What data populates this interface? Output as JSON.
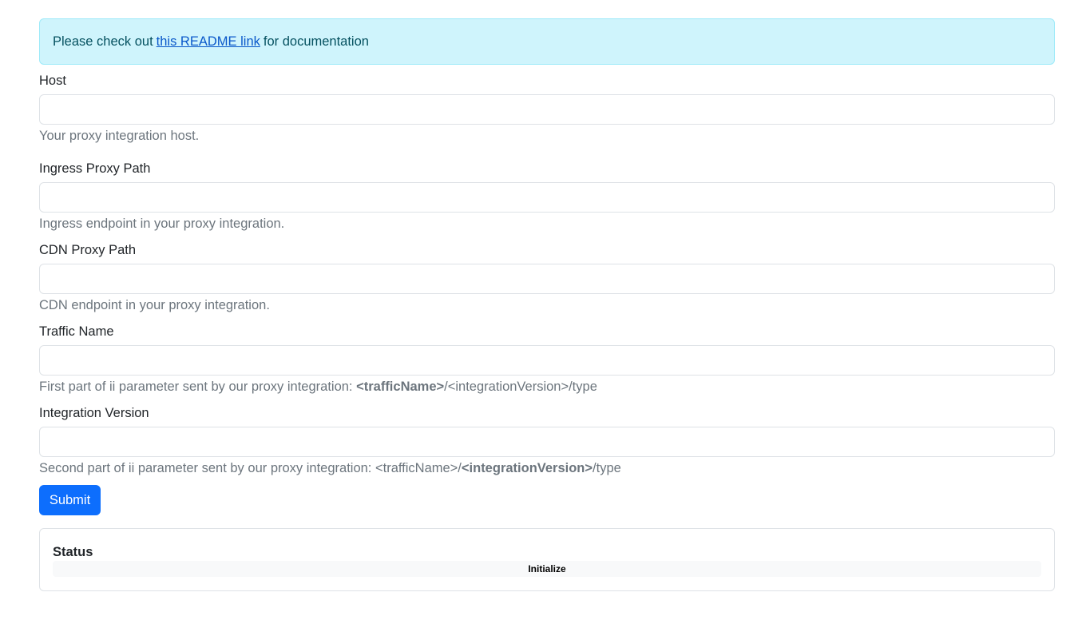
{
  "alert": {
    "prefix": "Please check out",
    "link_text": "this README link",
    "suffix": "for documentation"
  },
  "fields": {
    "host": {
      "label": "Host",
      "value": "",
      "help": "Your proxy integration host."
    },
    "ingress": {
      "label": "Ingress Proxy Path",
      "value": "",
      "help": "Ingress endpoint in your proxy integration."
    },
    "cdn": {
      "label": "CDN Proxy Path",
      "value": "",
      "help": "CDN endpoint in your proxy integration."
    },
    "traffic": {
      "label": "Traffic Name",
      "value": "",
      "help_prefix": "First part of ii parameter sent by our proxy integration: ",
      "help_bold": "<trafficName>",
      "help_suffix": "/<integrationVersion>/type"
    },
    "version": {
      "label": "Integration Version",
      "value": "",
      "help_prefix": "Second part of ii parameter sent by our proxy integration: <trafficName>/",
      "help_bold": "<integrationVersion>",
      "help_suffix": "/type"
    }
  },
  "submit_label": "Submit",
  "status": {
    "title": "Status",
    "text": "Initialize"
  }
}
